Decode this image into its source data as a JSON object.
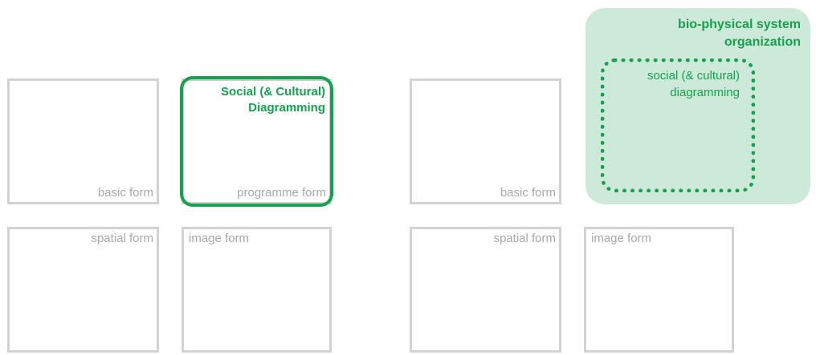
{
  "left_diagram": {
    "basic_form": "basic form",
    "programme_form": "programme form",
    "spatial_form": "spatial form",
    "image_form": "image form",
    "social_title_line1": "Social (& Cultural)",
    "social_title_line2": "Diagramming"
  },
  "right_diagram": {
    "bio_title_line1": "bio-physical system",
    "bio_title_line2": "organization",
    "social_title_line1": "social (& cultural)",
    "social_title_line2": "diagramming",
    "basic_form": "basic form",
    "spatial_form": "spatial form",
    "image_form": "image form"
  },
  "colors": {
    "accent_green": "#17a14d",
    "panel_green": "#cce9d9",
    "box_border": "#d2d2d2",
    "box_label": "#a8a8a8"
  }
}
